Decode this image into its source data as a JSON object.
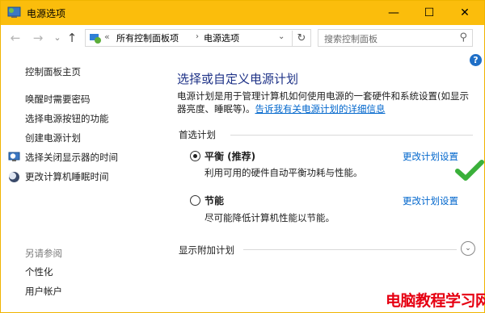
{
  "window": {
    "title": "电源选项",
    "min_glyph": "—",
    "max_glyph": "☐",
    "close_glyph": "✕"
  },
  "nav": {
    "back": "←",
    "forward": "→",
    "recent": "⌄",
    "up": "↑"
  },
  "address": {
    "overflow": "«",
    "crumbs": [
      "所有控制面板项",
      "电源选项"
    ],
    "separator": "›",
    "dropdown": "⌄",
    "refresh": "↻"
  },
  "search": {
    "placeholder": "搜索控制面板",
    "icon": "⚲"
  },
  "help": "?",
  "sidebar": {
    "home": "控制面板主页",
    "links": [
      "唤醒时需要密码",
      "选择电源按钮的功能",
      "创建电源计划",
      "选择关闭显示器的时间",
      "更改计算机睡眠时间"
    ],
    "see_also": "另请参阅",
    "see_also_links": [
      "个性化",
      "用户帐户"
    ]
  },
  "main": {
    "heading": "选择或自定义电源计划",
    "description": "电源计划是用于管理计算机如何使用电源的一套硬件和系统设置(如显示器亮度、睡眠等)。",
    "learn_more": "告诉我有关电源计划的详细信息",
    "preferred_label": "首选计划",
    "plans": [
      {
        "name": "平衡 (推荐)",
        "desc": "利用可用的硬件自动平衡功耗与性能。",
        "link": "更改计划设置",
        "selected": true
      },
      {
        "name": "节能",
        "desc": "尽可能降低计算机性能以节能。",
        "link": "更改计划设置",
        "selected": false
      }
    ],
    "additional_label": "显示附加计划",
    "expand_glyph": "⌄"
  },
  "watermark": "电脑教程学习网",
  "colors": {
    "titlebar": "#fbbd0c",
    "heading": "#1e3287",
    "link": "#0066cc",
    "check": "#3ab03a",
    "watermark": "#e60012"
  }
}
